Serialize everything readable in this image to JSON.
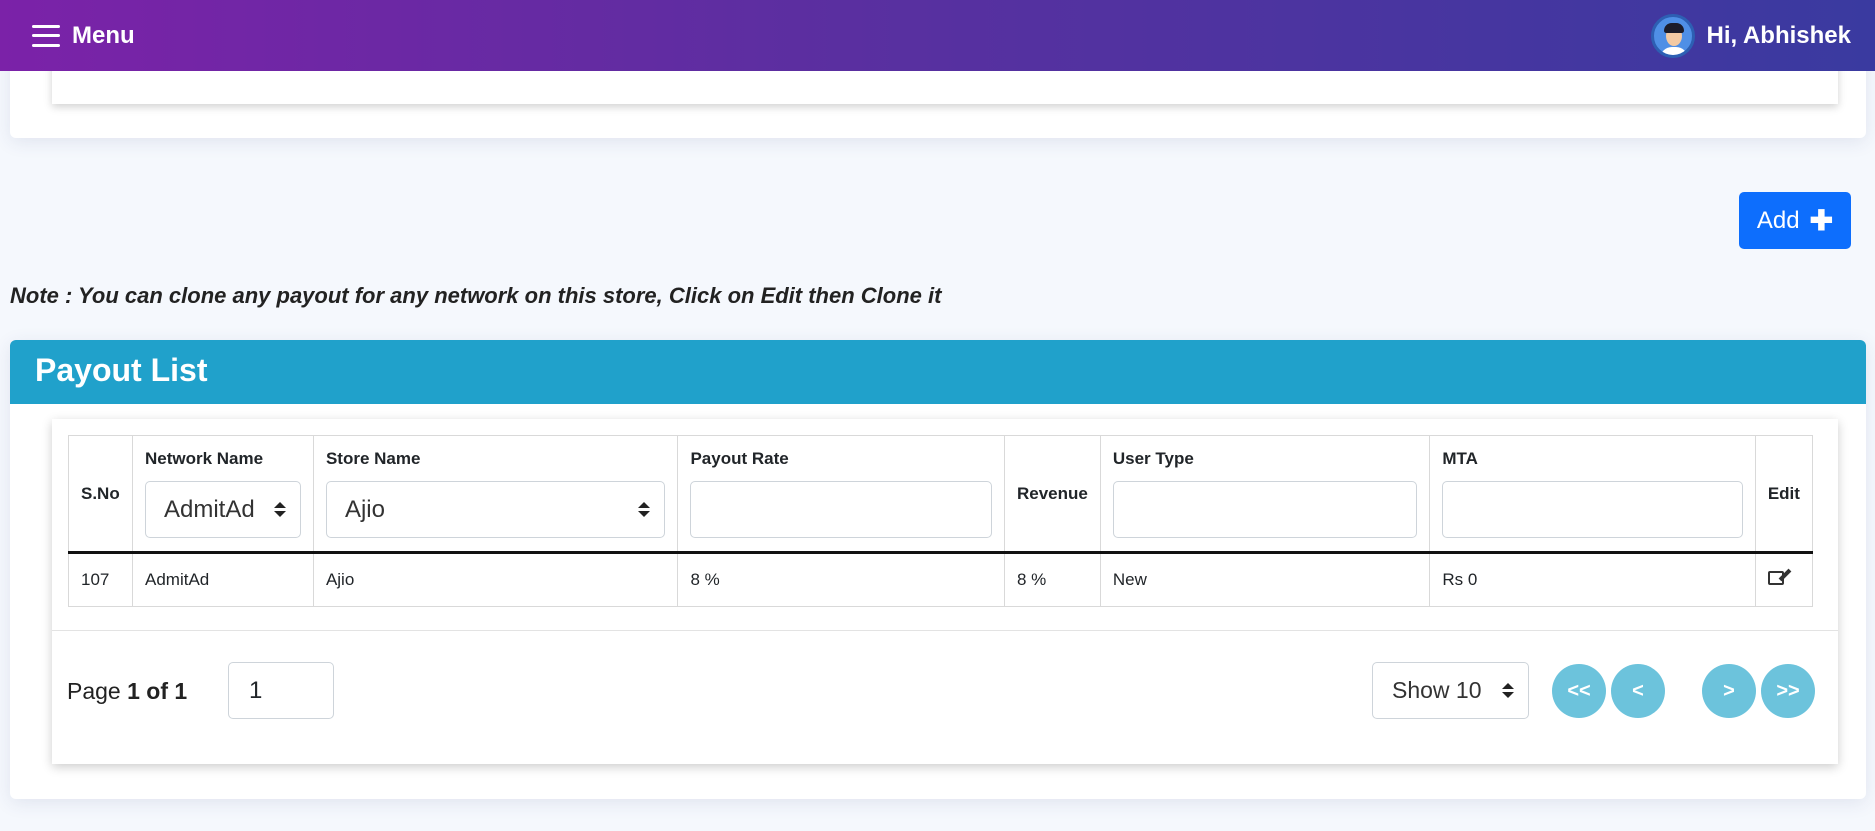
{
  "topbar": {
    "menu_label": "Menu",
    "greeting": "Hi, Abhishek"
  },
  "add_button": {
    "label": "Add"
  },
  "note": "Note : You can clone any payout for any network on this store, Click on Edit then Clone it",
  "payout_list": {
    "title": "Payout List",
    "columns": {
      "sno": "S.No",
      "network": "Network Name",
      "store": "Store Name",
      "payout_rate": "Payout Rate",
      "revenue": "Revenue",
      "user_type": "User Type",
      "mta": "MTA",
      "edit": "Edit"
    },
    "filters": {
      "network_selected": "AdmitAd",
      "store_selected": "Ajio"
    },
    "rows": [
      {
        "sno": "107",
        "network": "AdmitAd",
        "store": "Ajio",
        "payout_rate": "8 %",
        "revenue": "8 %",
        "user_type": "New",
        "mta": "Rs 0"
      }
    ]
  },
  "pagination": {
    "page_word": "Page",
    "page_of": "1 of 1",
    "page_input": "1",
    "show_selected": "Show 10",
    "first": "<<",
    "prev": "<",
    "next": ">",
    "last": ">>"
  }
}
